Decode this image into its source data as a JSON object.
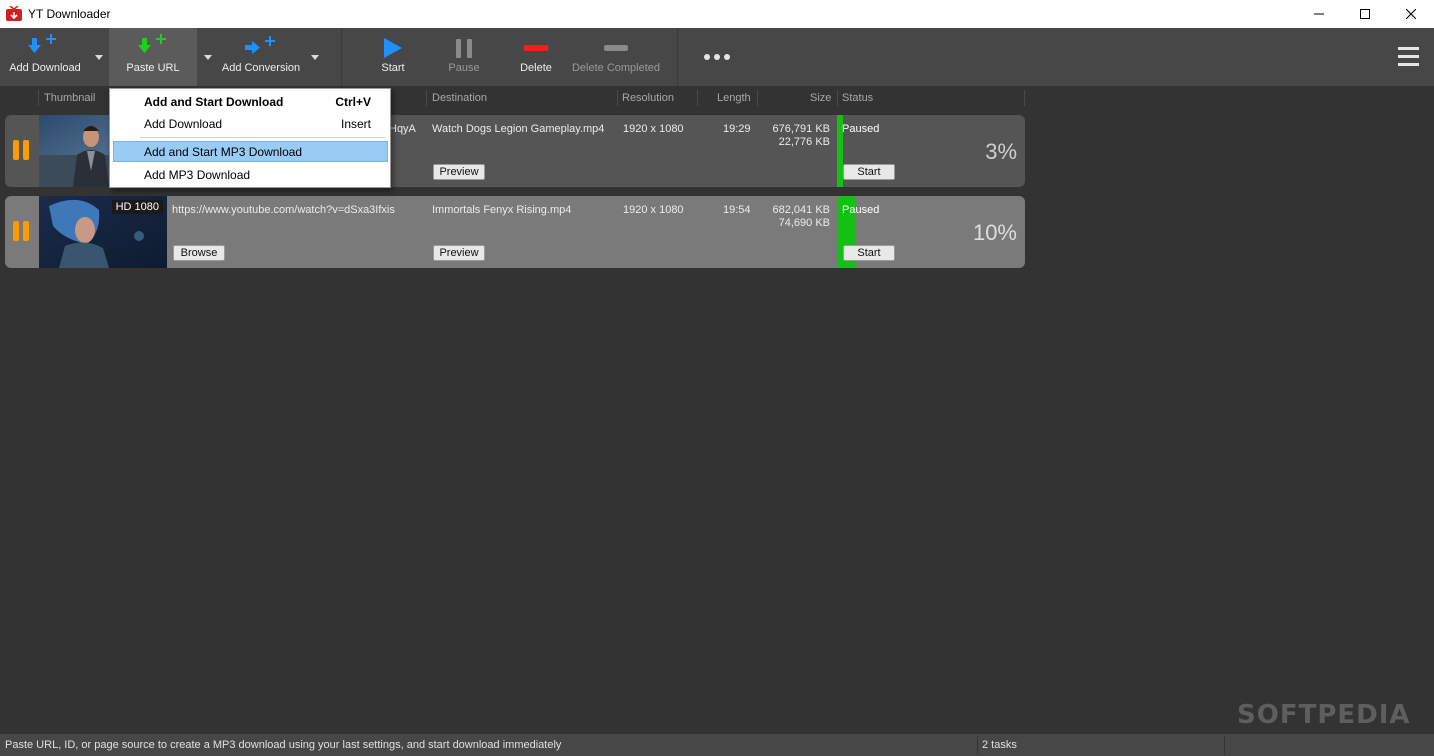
{
  "window": {
    "title": "YT Downloader",
    "controls": [
      "minimize-icon",
      "maximize-icon",
      "close-icon"
    ]
  },
  "toolbar": {
    "add_download": "Add Download",
    "paste_url": "Paste URL",
    "add_conversion": "Add Conversion",
    "start": "Start",
    "pause": "Pause",
    "delete": "Delete",
    "delete_completed": "Delete Completed",
    "more": "more-icon",
    "menu": "hamburger-menu-icon"
  },
  "colors": {
    "accent_blue": "#1e90ff",
    "green": "#13c113",
    "red": "#ff1a1a",
    "orange": "#ff9900"
  },
  "columns": {
    "thumbnail": "Thumbnail",
    "destination": "Destination",
    "resolution": "Resolution",
    "length": "Length",
    "size": "Size",
    "status": "Status"
  },
  "paste_menu": {
    "items": [
      {
        "label": "Add and Start Download",
        "shortcut": "Ctrl+V"
      },
      {
        "label": "Add Download",
        "shortcut": "Insert"
      },
      {
        "label": "Add and Start MP3 Download",
        "shortcut": ""
      },
      {
        "label": "Add MP3 Download",
        "shortcut": ""
      }
    ]
  },
  "downloads": [
    {
      "url_fragment": "HqyA",
      "destination": "Watch Dogs  Legion Gameplay.mp4",
      "preview_label": "Preview",
      "resolution": "1920 x 1080",
      "length": "19:29",
      "size_total": "676,791 KB",
      "size_done": "22,776 KB",
      "status": "Paused",
      "start_label": "Start",
      "progress": 3,
      "progress_text": "3%"
    },
    {
      "badge": "HD 1080",
      "url": "https://www.youtube.com/watch?v=dSxa3Ifxis",
      "browse_label": "Browse",
      "destination": "Immortals Fenyx Rising.mp4",
      "preview_label": "Preview",
      "resolution": "1920 x 1080",
      "length": "19:54",
      "size_total": "682,041 KB",
      "size_done": "74,690 KB",
      "status": "Paused",
      "start_label": "Start",
      "progress": 10,
      "progress_text": "10%"
    }
  ],
  "statusbar": {
    "message": "Paste URL, ID, or page source to create a MP3 download using your last settings, and start download immediately",
    "tasks": "2 tasks"
  },
  "watermark": "SOFTPEDIA"
}
